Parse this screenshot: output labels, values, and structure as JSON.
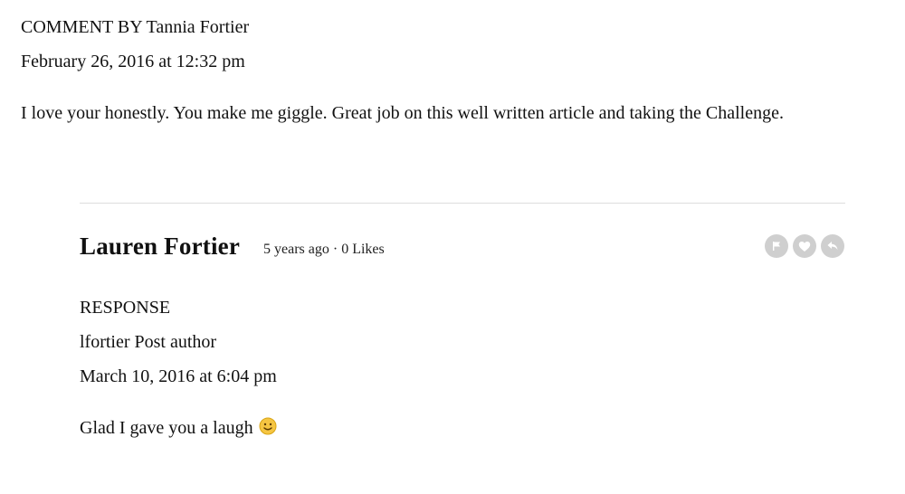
{
  "comment": {
    "header": "COMMENT BY Tannia Fortier",
    "date": "February 26, 2016 at 12:32 pm",
    "body": "I love your honestly. You make me giggle. Great job on this well written article and taking the Challenge."
  },
  "reply": {
    "author": "Lauren Fortier",
    "age": "5 years ago",
    "separator": "·",
    "likes": "0 Likes",
    "actions": {
      "flag_icon": "flag-icon",
      "like_icon": "heart-icon",
      "reply_icon": "reply-icon"
    },
    "response_label": "RESPONSE",
    "post_author_line": "lfortier Post author",
    "date": "March 10, 2016 at 6:04 pm",
    "body": "Glad I gave you a laugh",
    "emoji_icon": "smiley-emoji-icon"
  },
  "colors": {
    "text": "#111111",
    "divider": "#dddddd",
    "action_icon_bg": "#cfcfcf",
    "emoji": "#f5c542"
  }
}
